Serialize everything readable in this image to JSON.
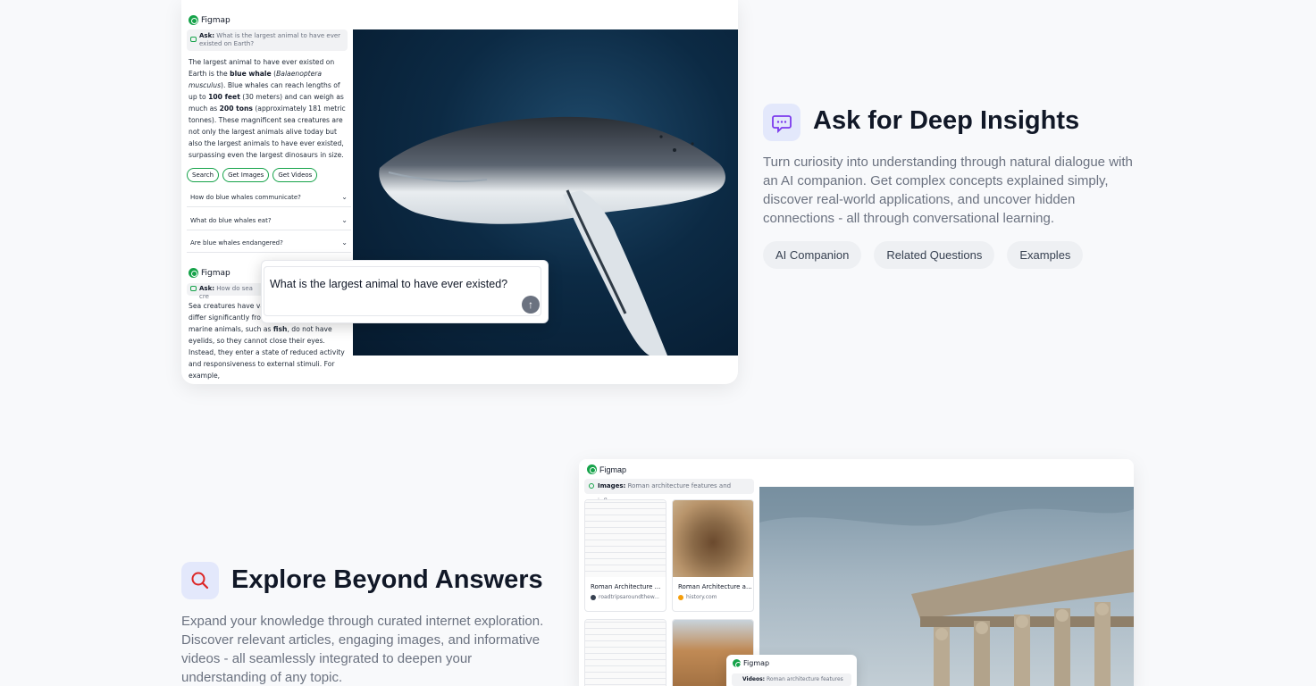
{
  "brand_name": "Figmap",
  "section1": {
    "title": "Ask for Deep Insights",
    "description": "Turn curiosity into understanding through natural dialogue with an AI companion. Get complex concepts explained simply, discover real-world applications, and uncover hidden connections - all through conversational learning.",
    "tags": [
      "AI Companion",
      "Related Questions",
      "Examples"
    ],
    "icon": "chat-bubble-icon",
    "accent_color": "#7c3aed"
  },
  "demo1": {
    "ask_label": "Ask:",
    "ask_query": "What is the largest animal to have ever existed on Earth?",
    "answer": {
      "t1": "The largest animal to have ever existed on Earth is the ",
      "b1": "blue whale",
      "t2": " (",
      "i1": "Balaenoptera musculus",
      "t3": "). Blue whales can reach lengths of up to ",
      "b2": "100 feet",
      "t4": " (30 meters) and can weigh as much as ",
      "b3": "200 tons",
      "t5": " (approximately 181 metric tonnes). These magnificent sea creatures are not only the largest animals alive today but also the largest animals to have ever existed, surpassing even the largest dinosaurs in size."
    },
    "actions": [
      "Search",
      "Get Images",
      "Get Videos"
    ],
    "related_questions": [
      "How do blue whales communicate?",
      "What do blue whales eat?",
      "Are blue whales endangered?"
    ],
    "second_ask_query": "How do sea cre",
    "second_answer": {
      "t1": "Sea creatures have va",
      "t2": "differ significantly fro",
      "t3": "marine animals, such as ",
      "b1": "fish",
      "t4": ", do not have eyelids, so they cannot close their eyes. Instead, they enter a state of reduced activity and responsiveness to external stimuli. For example,"
    },
    "prompt_text": "What is the largest animal to have ever existed?",
    "send_icon": "arrow-up-icon"
  },
  "section2": {
    "title": "Explore Beyond Answers",
    "description": "Expand your knowledge through curated internet exploration. Discover relevant articles, engaging images, and informative videos - all seamlessly integrated to deepen your understanding of any topic.",
    "icon": "search-icon",
    "accent_color": "#dc2626"
  },
  "demo2": {
    "images_label": "Images:",
    "images_query": "Roman architecture features and influence",
    "results": [
      {
        "title": "Roman Architecture ...",
        "source": "roadtripsaroundthew..."
      },
      {
        "title": "Roman Architecture a...",
        "source": "history.com"
      }
    ],
    "videos_label": "Videos:",
    "videos_query": "Roman architecture features"
  }
}
